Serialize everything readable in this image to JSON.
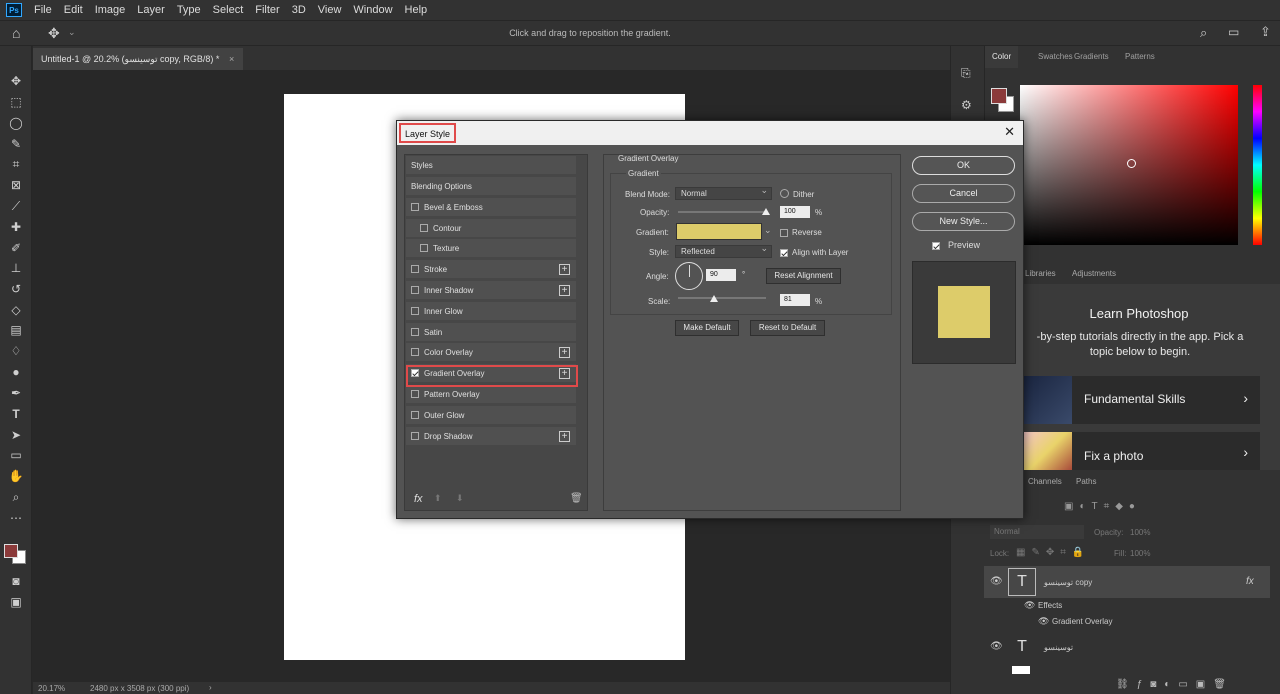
{
  "app": {
    "logo": "Ps",
    "menu": [
      "File",
      "Edit",
      "Image",
      "Layer",
      "Type",
      "Select",
      "Filter",
      "3D",
      "View",
      "Window",
      "Help"
    ]
  },
  "options_bar": {
    "hint": "Click and drag to reposition the gradient."
  },
  "document": {
    "tab_title": "Untitled-1 @ 20.2% (توسینسو copy, RGB/8) *",
    "zoom": "20.17%",
    "info": "2480 px x 3508 px (300 ppi)"
  },
  "color_panel": {
    "tabs": [
      "Color",
      "Swatches",
      "Gradients",
      "Patterns"
    ],
    "foreground": "#8b3a3a",
    "background": "#ffffff"
  },
  "learn_panel": {
    "tabs": [
      "Libraries",
      "Adjustments"
    ],
    "title": "Learn Photoshop",
    "description": "-by-step tutorials directly in the app. Pick a topic below to begin.",
    "cards": [
      {
        "label": "Fundamental Skills"
      },
      {
        "label": "Fix a photo"
      }
    ]
  },
  "layers_panel": {
    "tabs": [
      "Channels",
      "Paths"
    ],
    "blend_mode": "Normal",
    "opacity_label": "Opacity:",
    "opacity": "100%",
    "lock_label": "Lock:",
    "fill_label": "Fill:",
    "fill": "100%",
    "layers": [
      {
        "name": "توسینسو copy",
        "fx": "fx"
      },
      {
        "name": "Effects"
      },
      {
        "name": "Gradient Overlay"
      },
      {
        "name": "توسینسو"
      }
    ]
  },
  "dialog": {
    "title": "Layer Style",
    "styles_header": "Styles",
    "items": [
      {
        "label": "Blending Options",
        "checkbox": false,
        "plus": false,
        "checked": false
      },
      {
        "label": "Bevel & Emboss",
        "checkbox": true,
        "plus": false,
        "checked": false
      },
      {
        "label": "Contour",
        "checkbox": true,
        "plus": false,
        "checked": false
      },
      {
        "label": "Texture",
        "checkbox": true,
        "plus": false,
        "checked": false
      },
      {
        "label": "Stroke",
        "checkbox": true,
        "plus": true,
        "checked": false
      },
      {
        "label": "Inner Shadow",
        "checkbox": true,
        "plus": true,
        "checked": false
      },
      {
        "label": "Inner Glow",
        "checkbox": true,
        "plus": false,
        "checked": false
      },
      {
        "label": "Satin",
        "checkbox": true,
        "plus": false,
        "checked": false
      },
      {
        "label": "Color Overlay",
        "checkbox": true,
        "plus": true,
        "checked": false
      },
      {
        "label": "Gradient Overlay",
        "checkbox": true,
        "plus": true,
        "checked": true
      },
      {
        "label": "Pattern Overlay",
        "checkbox": true,
        "plus": false,
        "checked": false
      },
      {
        "label": "Outer Glow",
        "checkbox": true,
        "plus": false,
        "checked": false
      },
      {
        "label": "Drop Shadow",
        "checkbox": true,
        "plus": true,
        "checked": false
      }
    ],
    "fx_label": "fx",
    "section_title": "Gradient Overlay",
    "group_title": "Gradient",
    "blend_mode_label": "Blend Mode:",
    "blend_mode": "Normal",
    "dither_label": "Dither",
    "opacity_label": "Opacity:",
    "opacity": "100",
    "opacity_value": 1.0,
    "gradient_label": "Gradient:",
    "gradient_color": "#ddcc6a",
    "reverse_label": "Reverse",
    "style_label": "Style:",
    "style": "Reflected",
    "align_label": "Align with Layer",
    "angle_label": "Angle:",
    "angle": "90",
    "degree": "°",
    "reset_alignment": "Reset Alignment",
    "scale_label": "Scale:",
    "scale": "81",
    "scale_value": 0.81,
    "percent": "%",
    "make_default": "Make Default",
    "reset_default": "Reset to Default",
    "ok": "OK",
    "cancel": "Cancel",
    "new_style": "New Style...",
    "preview_label": "Preview",
    "preview_color": "#ddcc6a"
  }
}
